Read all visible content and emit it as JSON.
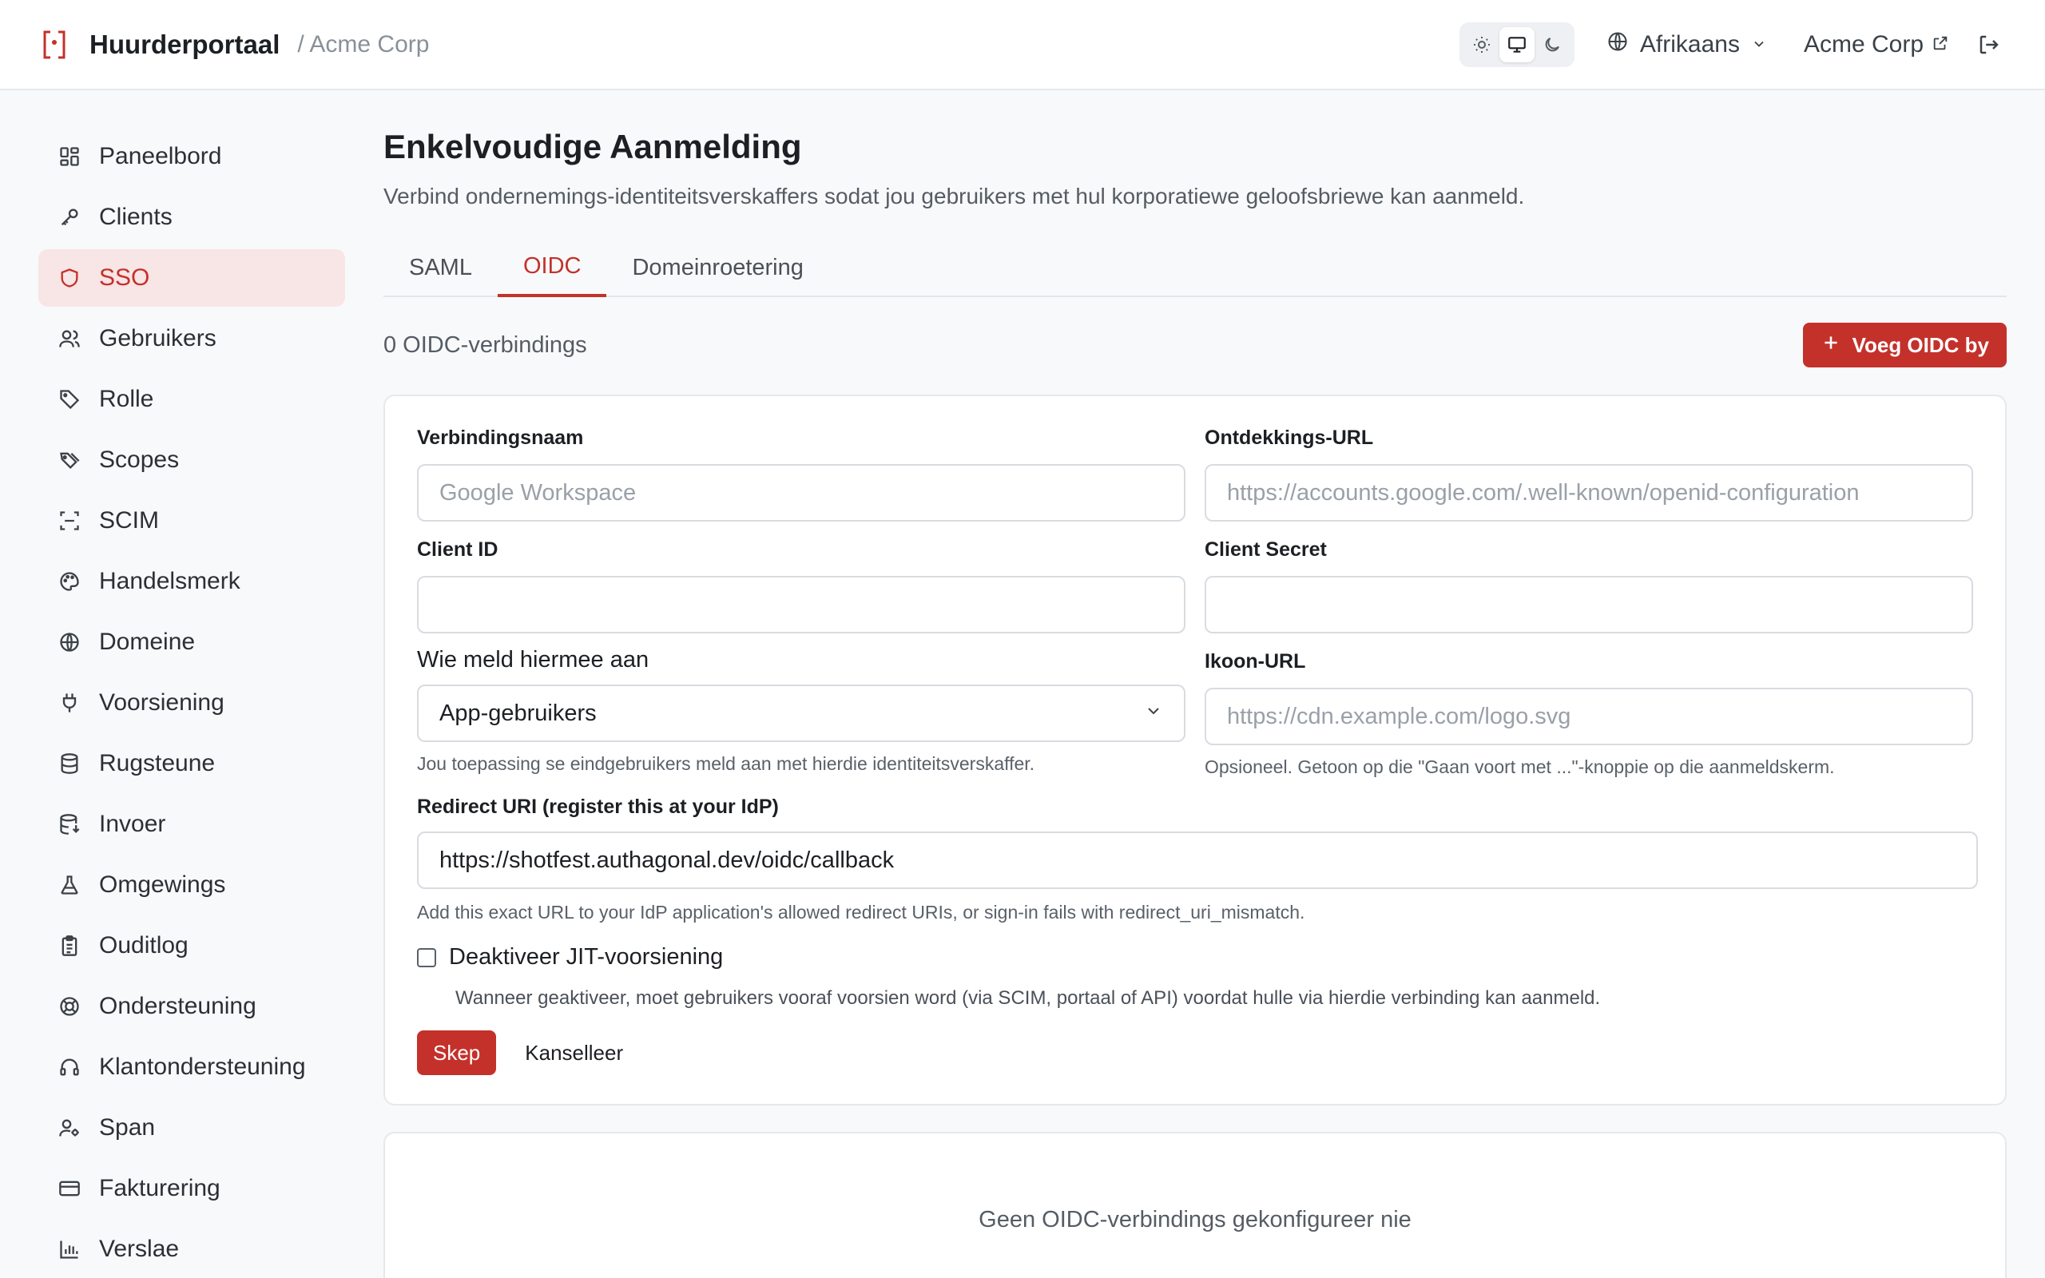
{
  "header": {
    "brand_name": "Huurderportaal",
    "org_crumb": "/ Acme Corp",
    "language": "Afrikaans",
    "org_link": "Acme Corp"
  },
  "sidebar": {
    "items": [
      {
        "label": "Paneelbord",
        "icon": "dashboard-icon"
      },
      {
        "label": "Clients",
        "icon": "key-icon"
      },
      {
        "label": "SSO",
        "icon": "shield-icon"
      },
      {
        "label": "Gebruikers",
        "icon": "users-icon"
      },
      {
        "label": "Rolle",
        "icon": "tag-icon"
      },
      {
        "label": "Scopes",
        "icon": "tags-icon"
      },
      {
        "label": "SCIM",
        "icon": "scan-icon"
      },
      {
        "label": "Handelsmerk",
        "icon": "palette-icon"
      },
      {
        "label": "Domeine",
        "icon": "globe-icon"
      },
      {
        "label": "Voorsiening",
        "icon": "plug-icon"
      },
      {
        "label": "Rugsteune",
        "icon": "database-icon"
      },
      {
        "label": "Invoer",
        "icon": "database-import-icon"
      },
      {
        "label": "Omgewings",
        "icon": "flask-icon"
      },
      {
        "label": "Ouditlog",
        "icon": "clipboard-icon"
      },
      {
        "label": "Ondersteuning",
        "icon": "lifebuoy-icon"
      },
      {
        "label": "Klantondersteuning",
        "icon": "headset-icon"
      },
      {
        "label": "Span",
        "icon": "user-cog-icon"
      },
      {
        "label": "Fakturering",
        "icon": "credit-card-icon"
      },
      {
        "label": "Verslae",
        "icon": "bar-chart-icon"
      }
    ],
    "active_index": 2
  },
  "main": {
    "title": "Enkelvoudige Aanmelding",
    "subtitle": "Verbind ondernemings-identiteitsverskaffers sodat jou gebruikers met hul korporatiewe geloofsbriewe kan aanmeld.",
    "tabs": [
      {
        "label": "SAML"
      },
      {
        "label": "OIDC"
      },
      {
        "label": "Domeinroetering"
      }
    ],
    "active_tab": 1,
    "count_text": "0 OIDC-verbindings",
    "add_button": "Voeg OIDC by"
  },
  "form": {
    "connection_name": {
      "label": "Verbindingsnaam",
      "placeholder": "Google Workspace",
      "value": ""
    },
    "discovery_url": {
      "label": "Ontdekkings-URL",
      "placeholder": "https://accounts.google.com/.well-known/openid-configuration",
      "value": ""
    },
    "client_id": {
      "label": "Client ID",
      "value": ""
    },
    "client_secret": {
      "label": "Client Secret",
      "value": ""
    },
    "who_signs_in": {
      "label": "Wie meld hiermee aan",
      "value": "App-gebruikers",
      "help": "Jou toepassing se eindgebruikers meld aan met hierdie identiteitsverskaffer."
    },
    "icon_url": {
      "label": "Ikoon-URL",
      "placeholder": "https://cdn.example.com/logo.svg",
      "value": "",
      "help": "Opsioneel. Getoon op die \"Gaan voort met ...\"-knoppie op die aanmeldskerm."
    },
    "redirect_uri": {
      "label": "Redirect URI (register this at your IdP)",
      "value": "https://shotfest.authagonal.dev/oidc/callback",
      "help": "Add this exact URL to your IdP application's allowed redirect URIs, or sign-in fails with redirect_uri_mismatch."
    },
    "jit": {
      "label": "Deaktiveer JIT-voorsiening",
      "checked": false,
      "help": "Wanneer geaktiveer, moet gebruikers vooraf voorsien word (via SCIM, portaal of API) voordat hulle via hierdie verbinding kan aanmeld."
    },
    "submit_label": "Skep",
    "cancel_label": "Kanselleer"
  },
  "empty_state": "Geen OIDC-verbindings gekonfigureer nie",
  "colors": {
    "accent": "#c4312b",
    "active_bg": "#f8e5e5"
  }
}
